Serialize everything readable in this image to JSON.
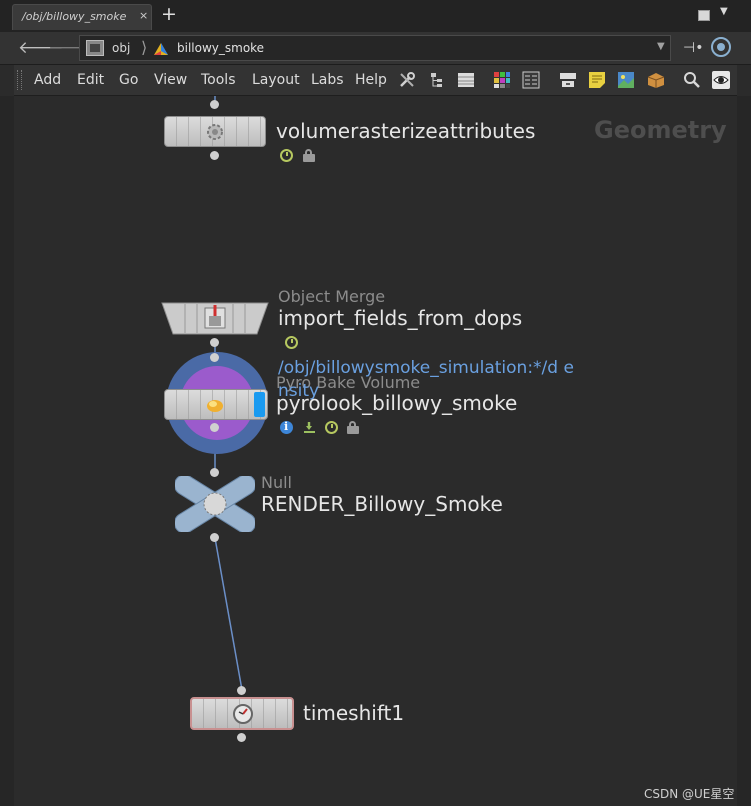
{
  "tabbar": {
    "active_tab": "/obj/billowy_smoke",
    "close_glyph": "×",
    "add_glyph": "+"
  },
  "pathbar": {
    "crumbs": [
      "obj",
      "billowy_smoke"
    ]
  },
  "menubar": {
    "items": [
      "Add",
      "Edit",
      "Go",
      "View",
      "Tools",
      "Layout",
      "Labs",
      "Help"
    ],
    "toolbar_icons": [
      "wrench-icon",
      "tree-icon",
      "list-icon",
      "color-grid-icon",
      "table-icon",
      "network-icon",
      "sticky-note-icon",
      "image-icon",
      "box-icon",
      "magnify-icon",
      "eye-icon"
    ]
  },
  "network": {
    "context_label": "Geometry",
    "nodes": [
      {
        "id": "volumerasterize",
        "name": "volumerasterizeattributes",
        "type": ""
      },
      {
        "id": "objectmerge",
        "name": "import_fields_from_dops",
        "type": "Object Merge",
        "annotation": "/obj/billowysmoke_simulation:*/d ensity"
      },
      {
        "id": "pyrobake",
        "name": "pyrolook_billowy_smoke",
        "type": "Pyro Bake Volume"
      },
      {
        "id": "null",
        "name": "RENDER_Billowy_Smoke",
        "type": "Null"
      },
      {
        "id": "timeshift",
        "name": "timeshift1",
        "type": ""
      }
    ],
    "colors": {
      "wire": "#6b8fc8",
      "highlight_ring": "#4a6aa6",
      "bake_ring": "#9b5bcc",
      "null_node": "#9ab4cf"
    }
  },
  "watermark": "CSDN @UE星空"
}
